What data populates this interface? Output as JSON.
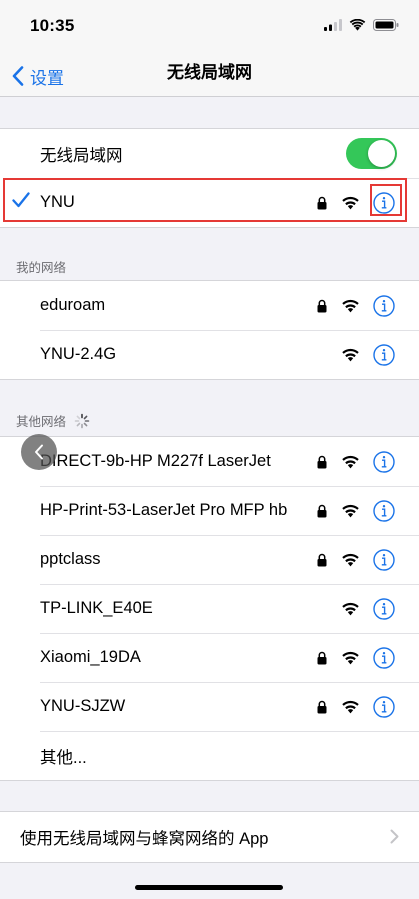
{
  "status_bar": {
    "time": "10:35"
  },
  "nav": {
    "back_label": "设置",
    "title": "无线局域网"
  },
  "wifi_toggle": {
    "label": "无线局域网",
    "on": true,
    "color": "#34c759"
  },
  "connected": {
    "name": "YNU",
    "secured": true,
    "icon": "checkmark-icon"
  },
  "my_networks": {
    "header": "我的网络",
    "items": [
      {
        "name": "eduroam",
        "secured": true
      },
      {
        "name": "YNU-2.4G",
        "secured": false
      }
    ]
  },
  "other_networks": {
    "header": "其他网络",
    "items": [
      {
        "name": "DIRECT-9b-HP M227f LaserJet",
        "secured": true
      },
      {
        "name": "HP-Print-53-LaserJet Pro MFP hb",
        "secured": true
      },
      {
        "name": "pptclass",
        "secured": true
      },
      {
        "name": "TP-LINK_E40E",
        "secured": false
      },
      {
        "name": "Xiaomi_19DA",
        "secured": true
      },
      {
        "name": "YNU-SJZW",
        "secured": true
      }
    ],
    "other_label": "其他..."
  },
  "apps_row": {
    "label": "使用无线局域网与蜂窝网络的 App"
  },
  "colors": {
    "accent": "#1a73e8",
    "toggle_on": "#34c759",
    "highlight": "#e53935"
  }
}
